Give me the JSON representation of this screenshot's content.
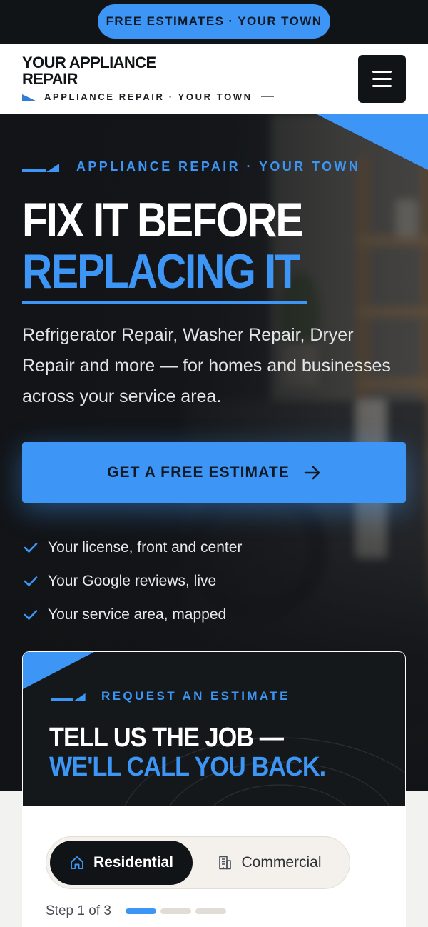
{
  "promo": {
    "label": "FREE ESTIMATES · YOUR TOWN"
  },
  "header": {
    "logo_title": "YOUR APPLIANCE REPAIR",
    "logo_tagline": "APPLIANCE REPAIR · YOUR TOWN",
    "menu_icon": "hamburger-menu-icon"
  },
  "hero": {
    "eyebrow": "APPLIANCE REPAIR · YOUR TOWN",
    "headline_line1": "FIX IT BEFORE",
    "headline_line2": "REPLACING IT",
    "subtitle": "Refrigerator Repair, Washer Repair, Dryer Repair and more — for homes and businesses across your service area.",
    "cta_label": "GET A FREE ESTIMATE",
    "cta_icon": "arrow-right-icon",
    "checks": [
      "Your license, front and center",
      "Your Google reviews, live",
      "Your service area, mapped"
    ]
  },
  "estimate": {
    "eyebrow": "REQUEST AN ESTIMATE",
    "title_line1": "TELL US THE JOB —",
    "title_line2": "WE'LL CALL YOU BACK.",
    "toggle": {
      "residential": "Residential",
      "commercial": "Commercial",
      "selected": "Residential"
    },
    "step_text": "Step 1 of 3",
    "step_current": 1,
    "step_total": 3
  },
  "colors": {
    "accent": "#3d96f5",
    "dark": "#111417",
    "light": "#ffffff"
  }
}
